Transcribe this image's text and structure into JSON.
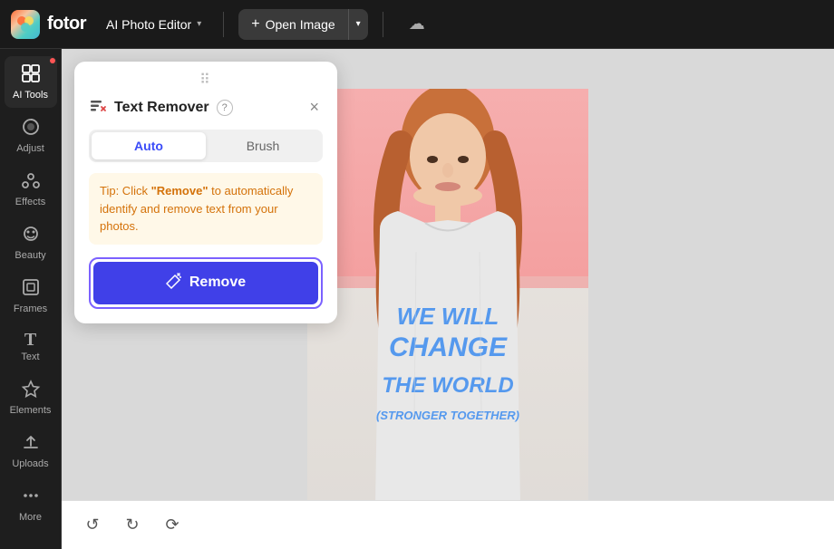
{
  "topbar": {
    "logo_text": "fotor",
    "ai_editor_label": "AI Photo Editor",
    "open_image_label": "Open Image",
    "cloud_icon": "☁"
  },
  "sidebar": {
    "items": [
      {
        "id": "ai-tools",
        "label": "AI Tools",
        "icon": "⊞",
        "active": true
      },
      {
        "id": "adjust",
        "label": "Adjust",
        "icon": "◐"
      },
      {
        "id": "effects",
        "label": "Effects",
        "icon": "✦"
      },
      {
        "id": "beauty",
        "label": "Beauty",
        "icon": "◎"
      },
      {
        "id": "frames",
        "label": "Frames",
        "icon": "▣"
      },
      {
        "id": "text",
        "label": "Text",
        "icon": "T"
      },
      {
        "id": "elements",
        "label": "Elements",
        "icon": "❋"
      },
      {
        "id": "uploads",
        "label": "Uploads",
        "icon": "⬆"
      },
      {
        "id": "more",
        "label": "More",
        "icon": "•••"
      }
    ]
  },
  "card": {
    "title": "Text Remover",
    "help_icon": "?",
    "close_icon": "×",
    "tabs": [
      {
        "id": "auto",
        "label": "Auto",
        "active": true
      },
      {
        "id": "brush",
        "label": "Brush",
        "active": false
      }
    ],
    "tip": {
      "prefix": "Tip: Click ",
      "highlight": "\"Remove\"",
      "suffix": " to automatically identify and remove text from your photos."
    },
    "remove_button_label": "Remove"
  },
  "bottom": {
    "undo_icon": "↺",
    "redo_icon": "↻",
    "reset_icon": "⟳"
  },
  "photo": {
    "text_line1": "WE WILL",
    "text_line2": "CHANGE",
    "text_line3": "THE WORLD",
    "text_line4": "(STRONGER TOGETHER)"
  }
}
